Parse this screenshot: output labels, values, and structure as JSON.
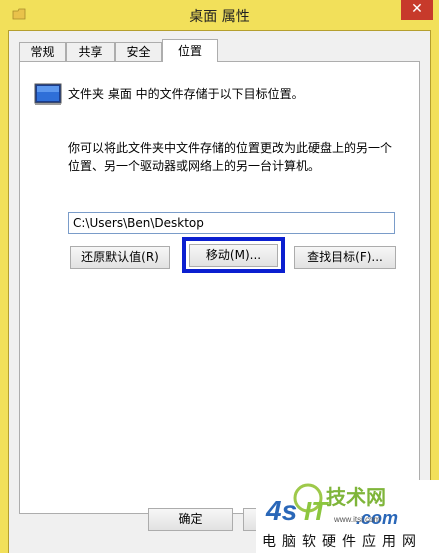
{
  "window": {
    "title": "桌面 属性",
    "close_label": "✕"
  },
  "tabs": [
    {
      "label": "常规",
      "active": false
    },
    {
      "label": "共享",
      "active": false
    },
    {
      "label": "安全",
      "active": false
    },
    {
      "label": "位置",
      "active": true
    }
  ],
  "location": {
    "heading": "文件夹 桌面 中的文件存储于以下目标位置。",
    "description": "你可以将此文件夹中文件存储的位置更改为此硬盘上的另一个位置、另一个驱动器或网络上的另一台计算机。",
    "path_value": "C:\\Users\\Ben\\Desktop",
    "restore_label": "还原默认值(R)",
    "move_label": "移动(M)...",
    "find_label": "查找目标(F)..."
  },
  "footer": {
    "ok_label": "确定"
  },
  "watermark": {
    "logo_text": "4s IT .com",
    "site": "www.itsi.com",
    "brand_line": "电脑软硬件应用网"
  },
  "colors": {
    "titlebar": "#f2e05a",
    "close": "#c73a2b",
    "highlight": "#0b1fd0"
  },
  "icons": {
    "title": "folder-icon",
    "location": "monitor-folder-icon"
  }
}
